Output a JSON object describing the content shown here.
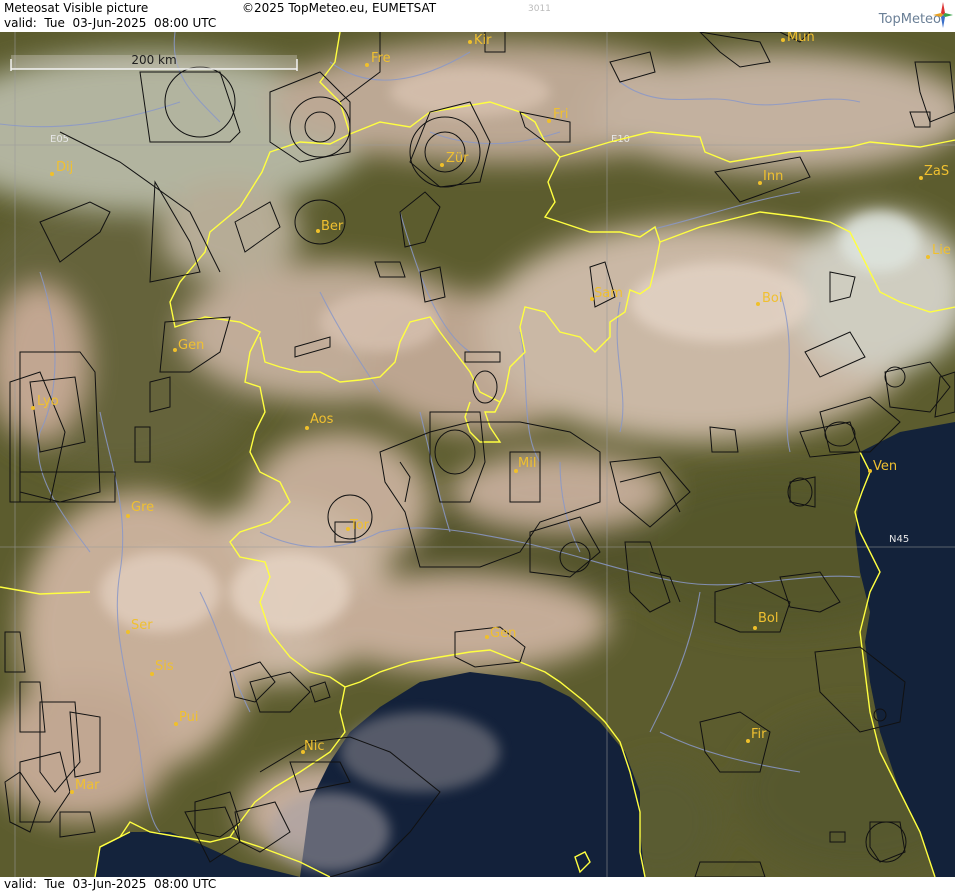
{
  "header": {
    "title": "Meteosat Visible picture",
    "copyright": "©2025 TopMeteo.eu, EUMETSAT",
    "valid": "valid:  Tue  03-Jun-2025  08:00 UTC",
    "map_id": "3011",
    "brand": "TopMeteo"
  },
  "footer": {
    "valid": "valid:  Tue  03-Jun-2025  08:00 UTC"
  },
  "map": {
    "scale_bar": "200 km",
    "grid_labels": {
      "e05": "E05",
      "e10": "E10",
      "n45": "N45"
    },
    "cities": {
      "kir": "Kir",
      "fre": "Fre",
      "mun": "Mun",
      "fri": "Fri",
      "dij": "Dij",
      "zur": "Zür",
      "inn": "Inn",
      "zas": "ZaS",
      "ber": "Ber",
      "lie": "Lie",
      "sam": "Sam",
      "bol_north": "Bol",
      "gen_ch": "Gen",
      "lyo": "Lyo",
      "aos": "Aos",
      "mil": "Mil",
      "ven": "Ven",
      "gre": "Gre",
      "tor": "Tor",
      "ser": "Ser",
      "gen_it": "Gen",
      "bol_south": "Bol",
      "sis": "Sis",
      "pui": "Pui",
      "nic": "Nic",
      "fir": "Fir",
      "mar": "Mar"
    },
    "colors": {
      "sea": "#13213a",
      "land": "#5a5a2c",
      "cloud": "#d2b8a6",
      "border": "#ffff40",
      "airspace": "#111111",
      "river": "#8a98c8",
      "city": "#f0c030"
    }
  }
}
